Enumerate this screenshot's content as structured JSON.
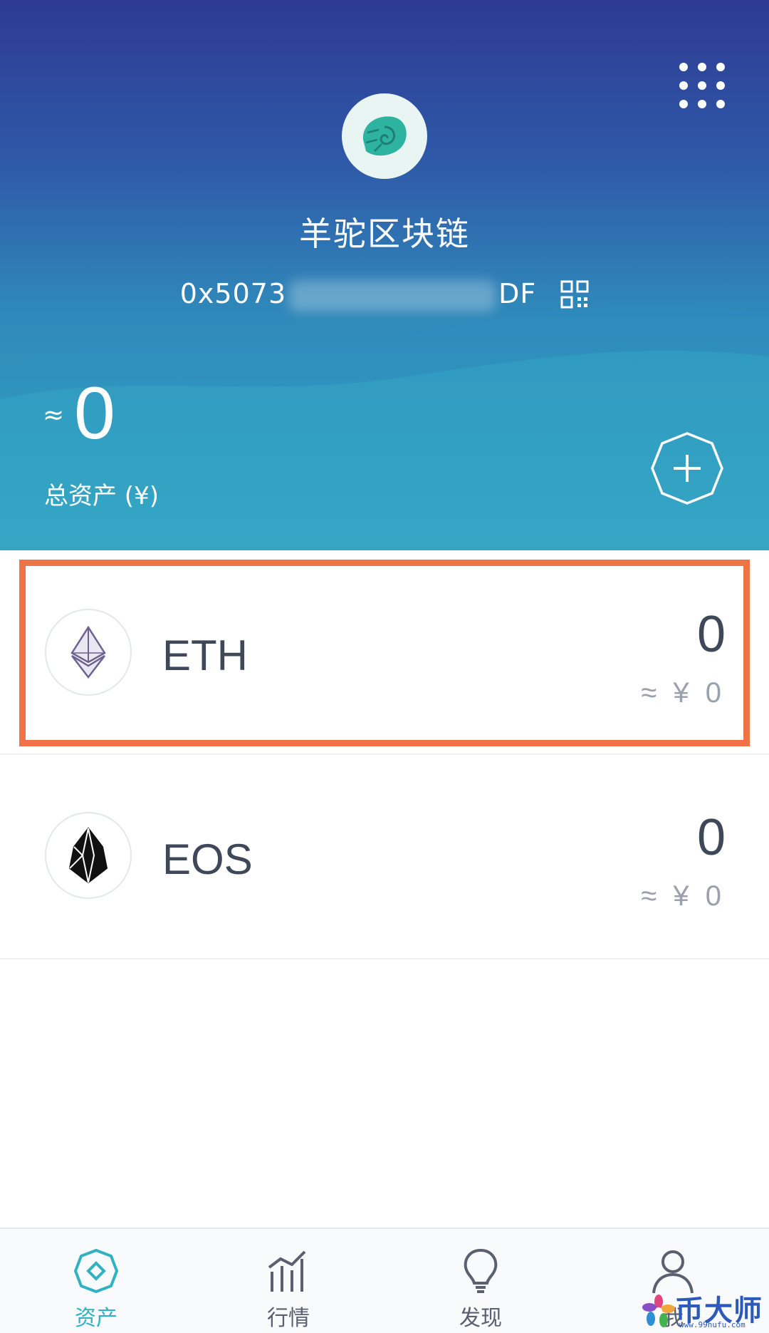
{
  "header": {
    "wallet_name": "羊驼区块链",
    "address_prefix": "0x5073",
    "address_suffix": "DF",
    "approx_sign": "≈",
    "total_value": "0",
    "total_label": "总资产 (¥)"
  },
  "assets": [
    {
      "symbol": "ETH",
      "amount": "0",
      "fiat": "≈ ¥ 0",
      "icon": "ethereum-icon",
      "highlighted": true
    },
    {
      "symbol": "EOS",
      "amount": "0",
      "fiat": "≈ ¥ 0",
      "icon": "eos-icon",
      "highlighted": false
    }
  ],
  "nav": [
    {
      "label": "资产",
      "icon": "assets-icon",
      "active": true
    },
    {
      "label": "行情",
      "icon": "market-chart-icon",
      "active": false
    },
    {
      "label": "发现",
      "icon": "lightbulb-icon",
      "active": false
    },
    {
      "label": "我",
      "icon": "profile-icon",
      "active": false
    }
  ],
  "watermark": {
    "text": "币大师",
    "url": "www.99hufu.com"
  },
  "colors": {
    "accent": "#32b1c2",
    "highlight_border": "#f07348",
    "header_top": "#2d3a93",
    "header_bottom": "#38b1c7"
  }
}
